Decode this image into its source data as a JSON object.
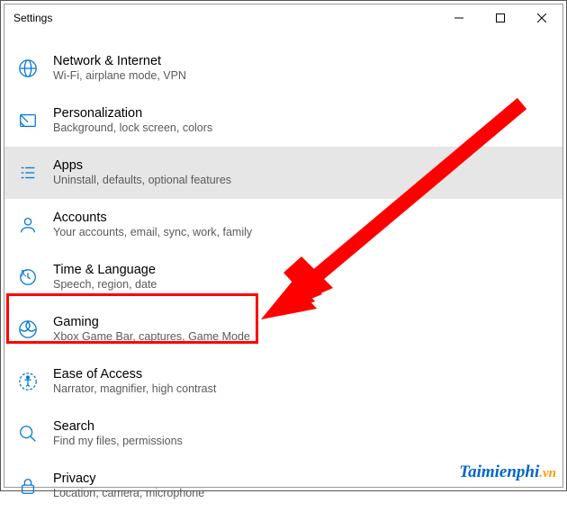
{
  "window": {
    "title": "Settings"
  },
  "items": [
    {
      "title": "Network & Internet",
      "sub": "Wi-Fi, airplane mode, VPN",
      "icon": "globe-icon",
      "selected": false
    },
    {
      "title": "Personalization",
      "sub": "Background, lock screen, colors",
      "icon": "personalization-icon",
      "selected": false
    },
    {
      "title": "Apps",
      "sub": "Uninstall, defaults, optional features",
      "icon": "apps-icon",
      "selected": true
    },
    {
      "title": "Accounts",
      "sub": "Your accounts, email, sync, work, family",
      "icon": "accounts-icon",
      "selected": false
    },
    {
      "title": "Time & Language",
      "sub": "Speech, region, date",
      "icon": "time-language-icon",
      "selected": false
    },
    {
      "title": "Gaming",
      "sub": "Xbox Game Bar, captures, Game Mode",
      "icon": "gaming-icon",
      "selected": false
    },
    {
      "title": "Ease of Access",
      "sub": "Narrator, magnifier, high contrast",
      "icon": "ease-of-access-icon",
      "selected": false
    },
    {
      "title": "Search",
      "sub": "Find my files, permissions",
      "icon": "search-icon",
      "selected": false
    },
    {
      "title": "Privacy",
      "sub": "Location, camera, microphone",
      "icon": "privacy-icon",
      "selected": false
    }
  ],
  "watermark": {
    "part1": "Taimienphi",
    "part2": ".vn"
  },
  "annotation": {
    "highlight_index": 5
  }
}
